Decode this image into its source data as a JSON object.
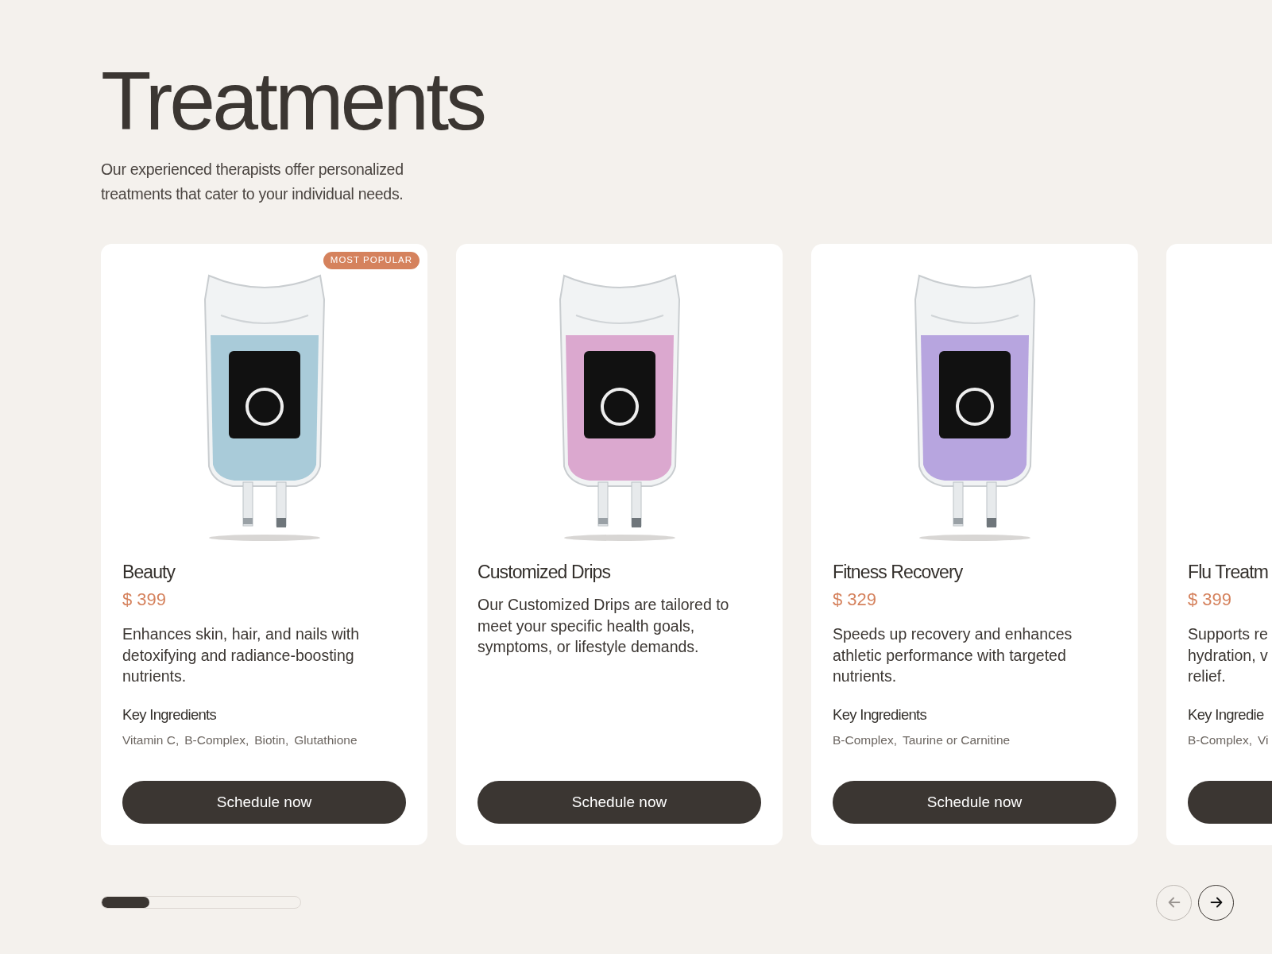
{
  "heading": "Treatments",
  "intro": "Our experienced therapists offer personalized treatments that cater to your individual needs.",
  "cards": [
    {
      "badge": "MOST POPULAR",
      "color": "#a9cbd9",
      "name": "Beauty",
      "price": "$ 399",
      "description": "Enhances skin, hair, and nails with detoxifying and radiance-boosting nutrients.",
      "ingredients_title": "Key Ingredients",
      "ingredients": [
        "Vitamin C,",
        "B-Complex,",
        "Biotin,",
        "Glutathione"
      ],
      "button": "Schedule now"
    },
    {
      "color": "#dba8cf",
      "name": "Customized Drips",
      "description": "Our Customized Drips are tailored to meet your specific health goals, symptoms, or lifestyle demands.",
      "button": "Schedule now"
    },
    {
      "color": "#b7a5df",
      "name": "Fitness Recovery",
      "price": "$ 329",
      "description": "Speeds up recovery and enhances athletic performance with targeted nutrients.",
      "ingredients_title": "Key Ingredients",
      "ingredients": [
        "B-Complex,",
        "Taurine or Carnitine"
      ],
      "button": "Schedule now"
    },
    {
      "name": "Flu Treatm",
      "price": "$ 399",
      "description": "Supports re\nhydration, v\nrelief.",
      "ingredients_title": "Key Ingredie",
      "ingredients": [
        "B-Complex,",
        "Vi"
      ]
    }
  ],
  "progress": {
    "level": 0.24
  },
  "nav": {
    "prev": {
      "disabled": true
    },
    "next": {
      "disabled": false
    }
  }
}
